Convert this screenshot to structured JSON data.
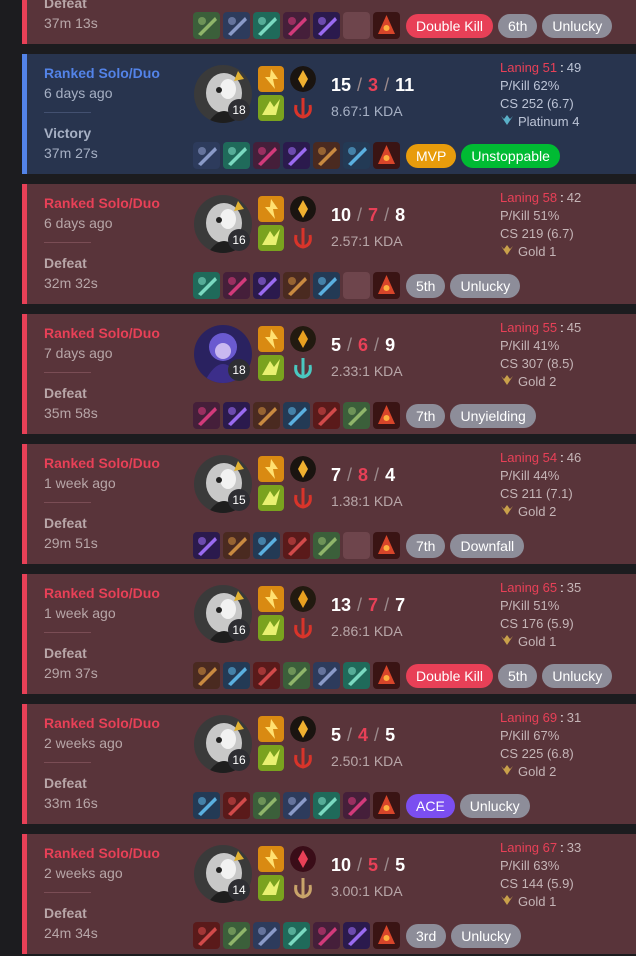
{
  "matches": [
    {
      "result": "Defeat",
      "duration": "37m 13s",
      "badges": [
        {
          "label": "Double Kill",
          "color": "red"
        },
        {
          "label": "6th",
          "color": "grey"
        },
        {
          "label": "Unlucky",
          "color": "grey"
        }
      ]
    },
    {
      "queue": "Ranked Solo/Duo",
      "ago": "6 days ago",
      "result": "Victory",
      "duration": "37m 27s",
      "level": "18",
      "kills": "15",
      "deaths": "3",
      "assists": "11",
      "kda": "8.67:1 KDA",
      "laning_a": "Laning 51",
      "laning_b": "49",
      "pkill": "P/Kill 62%",
      "cs": "CS 252 (6.7)",
      "tier": "Platinum 4",
      "badges": [
        {
          "label": "MVP",
          "color": "orange"
        },
        {
          "label": "Unstoppable",
          "color": "green"
        }
      ]
    },
    {
      "queue": "Ranked Solo/Duo",
      "ago": "6 days ago",
      "result": "Defeat",
      "duration": "32m 32s",
      "level": "16",
      "kills": "10",
      "deaths": "7",
      "assists": "8",
      "kda": "2.57:1 KDA",
      "laning_a": "Laning 58",
      "laning_b": "42",
      "pkill": "P/Kill 51%",
      "cs": "CS 219 (6.7)",
      "tier": "Gold 1",
      "badges": [
        {
          "label": "5th",
          "color": "grey"
        },
        {
          "label": "Unlucky",
          "color": "grey"
        }
      ]
    },
    {
      "queue": "Ranked Solo/Duo",
      "ago": "7 days ago",
      "result": "Defeat",
      "duration": "35m 58s",
      "level": "18",
      "kills": "5",
      "deaths": "6",
      "assists": "9",
      "kda": "2.33:1 KDA",
      "laning_a": "Laning 55",
      "laning_b": "45",
      "pkill": "P/Kill 41%",
      "cs": "CS 307 (8.5)",
      "tier": "Gold 2",
      "badges": [
        {
          "label": "7th",
          "color": "grey"
        },
        {
          "label": "Unyielding",
          "color": "grey"
        }
      ]
    },
    {
      "queue": "Ranked Solo/Duo",
      "ago": "1 week ago",
      "result": "Defeat",
      "duration": "29m 51s",
      "level": "15",
      "kills": "7",
      "deaths": "8",
      "assists": "4",
      "kda": "1.38:1 KDA",
      "laning_a": "Laning 54",
      "laning_b": "46",
      "pkill": "P/Kill 44%",
      "cs": "CS 211 (7.1)",
      "tier": "Gold 2",
      "badges": [
        {
          "label": "7th",
          "color": "grey"
        },
        {
          "label": "Downfall",
          "color": "grey"
        }
      ]
    },
    {
      "queue": "Ranked Solo/Duo",
      "ago": "1 week ago",
      "result": "Defeat",
      "duration": "29m 37s",
      "level": "16",
      "kills": "13",
      "deaths": "7",
      "assists": "7",
      "kda": "2.86:1 KDA",
      "laning_a": "Laning 65",
      "laning_b": "35",
      "pkill": "P/Kill 51%",
      "cs": "CS 176 (5.9)",
      "tier": "Gold 1",
      "badges": [
        {
          "label": "Double Kill",
          "color": "red"
        },
        {
          "label": "5th",
          "color": "grey"
        },
        {
          "label": "Unlucky",
          "color": "grey"
        }
      ]
    },
    {
      "queue": "Ranked Solo/Duo",
      "ago": "2 weeks ago",
      "result": "Defeat",
      "duration": "33m 16s",
      "level": "16",
      "kills": "5",
      "deaths": "4",
      "assists": "5",
      "kda": "2.50:1 KDA",
      "laning_a": "Laning 69",
      "laning_b": "31",
      "pkill": "P/Kill 67%",
      "cs": "CS 225 (6.8)",
      "tier": "Gold 2",
      "badges": [
        {
          "label": "ACE",
          "color": "purple"
        },
        {
          "label": "Unlucky",
          "color": "grey"
        }
      ]
    },
    {
      "queue": "Ranked Solo/Duo",
      "ago": "2 weeks ago",
      "result": "Defeat",
      "duration": "24m 34s",
      "level": "14",
      "kills": "10",
      "deaths": "5",
      "assists": "5",
      "kda": "3.00:1 KDA",
      "laning_a": "Laning 67",
      "laning_b": "33",
      "pkill": "P/Kill 63%",
      "cs": "CS 144 (5.9)",
      "tier": "Gold 1",
      "badges": [
        {
          "label": "3rd",
          "color": "grey"
        },
        {
          "label": "Unlucky",
          "color": "grey"
        }
      ]
    }
  ],
  "colors": {
    "win_accent": "#5383e8",
    "loss_accent": "#e84057",
    "win_bg": "#28344e",
    "loss_bg": "#59343a"
  }
}
